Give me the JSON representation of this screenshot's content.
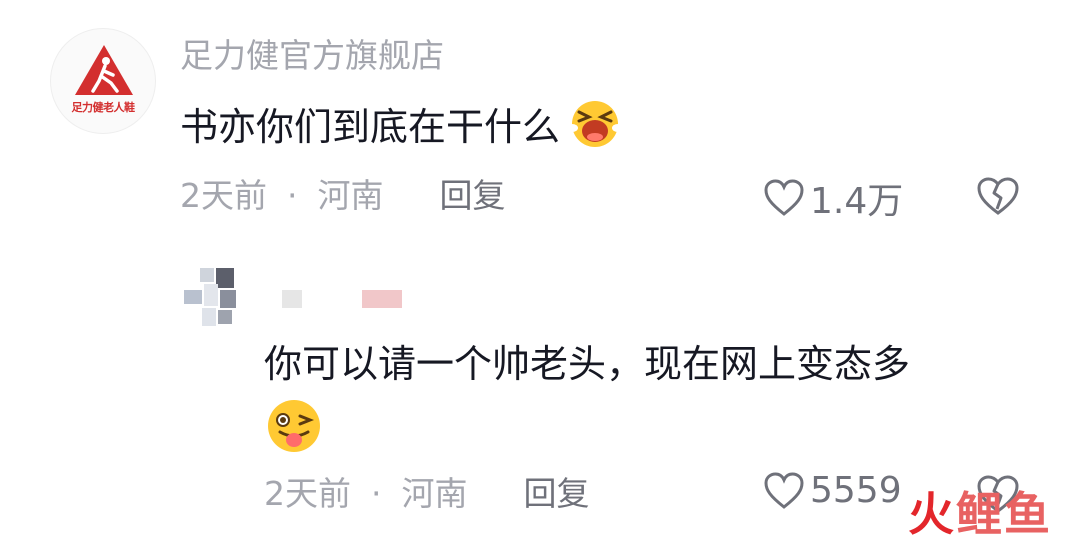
{
  "comment": {
    "avatar_icon": "brand-logo-avatar",
    "avatar_logo_text": "足力健老人鞋",
    "username": "足力健官方旗舰店",
    "text": "书亦你们到底在干什么",
    "emoji": "crying-laughing-emoji",
    "time": "2天前",
    "separator": "·",
    "location": "河南",
    "reply_label": "回复",
    "likes": "1.4万",
    "like_icon": "heart-outline-icon",
    "dislike_icon": "broken-heart-icon"
  },
  "reply": {
    "avatar_icon": "blurred-avatar",
    "text": "你可以请一个帅老头，现在网上变态多",
    "emoji": "winking-tongue-emoji",
    "time": "2天前",
    "separator": "·",
    "location": "河南",
    "reply_label": "回复",
    "likes": "5559",
    "like_icon": "heart-outline-icon",
    "dislike_icon": "broken-heart-icon"
  },
  "watermark": {
    "part1": "火",
    "part2": "鲤鱼"
  },
  "colors": {
    "text_primary": "#161823",
    "text_secondary": "#a4a6ae",
    "brand_red": "#d32f2f",
    "watermark_red": "#e3262b"
  }
}
